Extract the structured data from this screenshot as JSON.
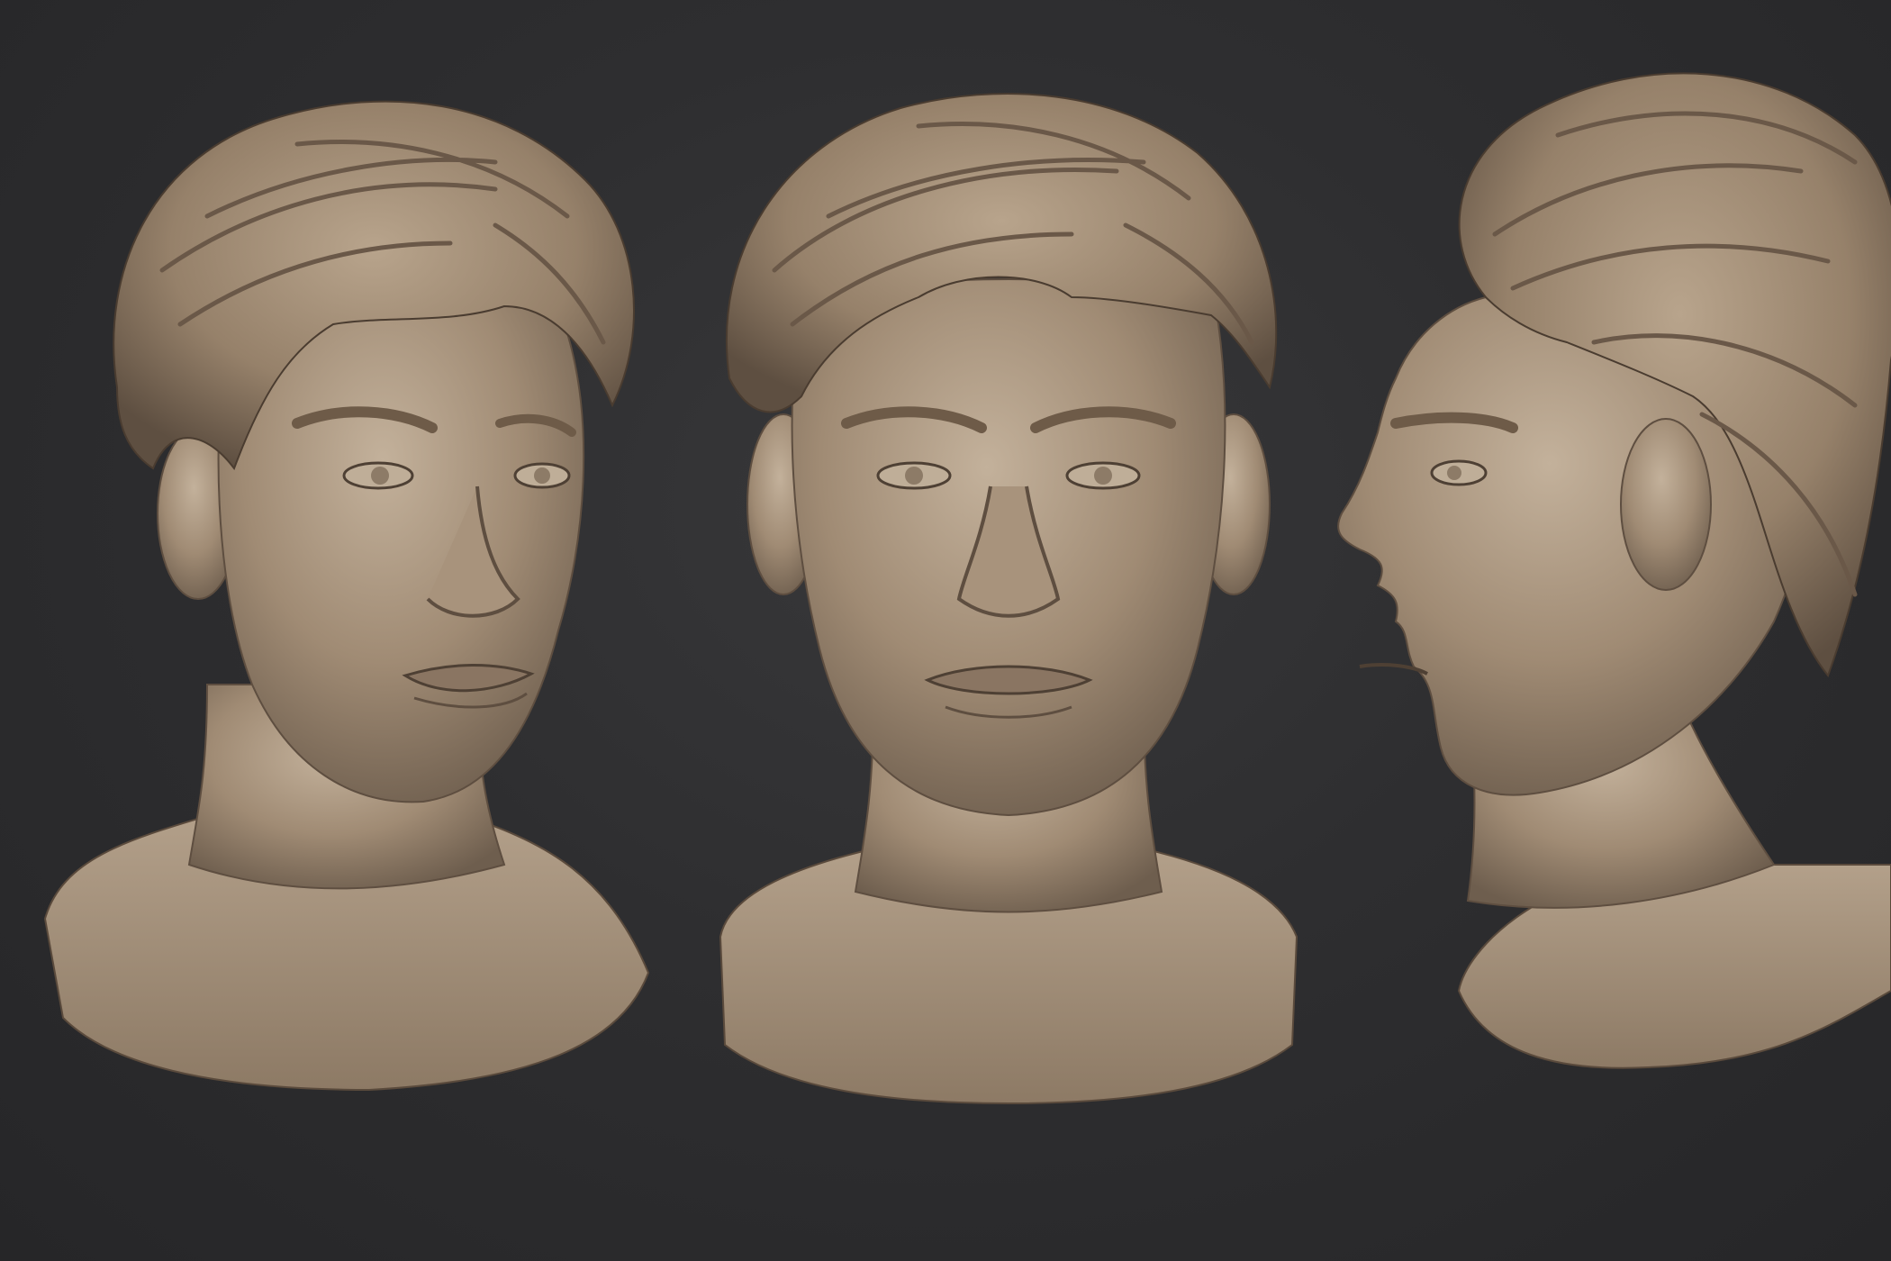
{
  "scene": {
    "background_color": "#2b2b2d",
    "material_color": "#a8957f",
    "views": [
      {
        "name": "three-quarter-view",
        "description_icon": "bust-three-quarter"
      },
      {
        "name": "front-view",
        "description_icon": "bust-front"
      },
      {
        "name": "profile-view",
        "description_icon": "bust-profile"
      }
    ]
  }
}
